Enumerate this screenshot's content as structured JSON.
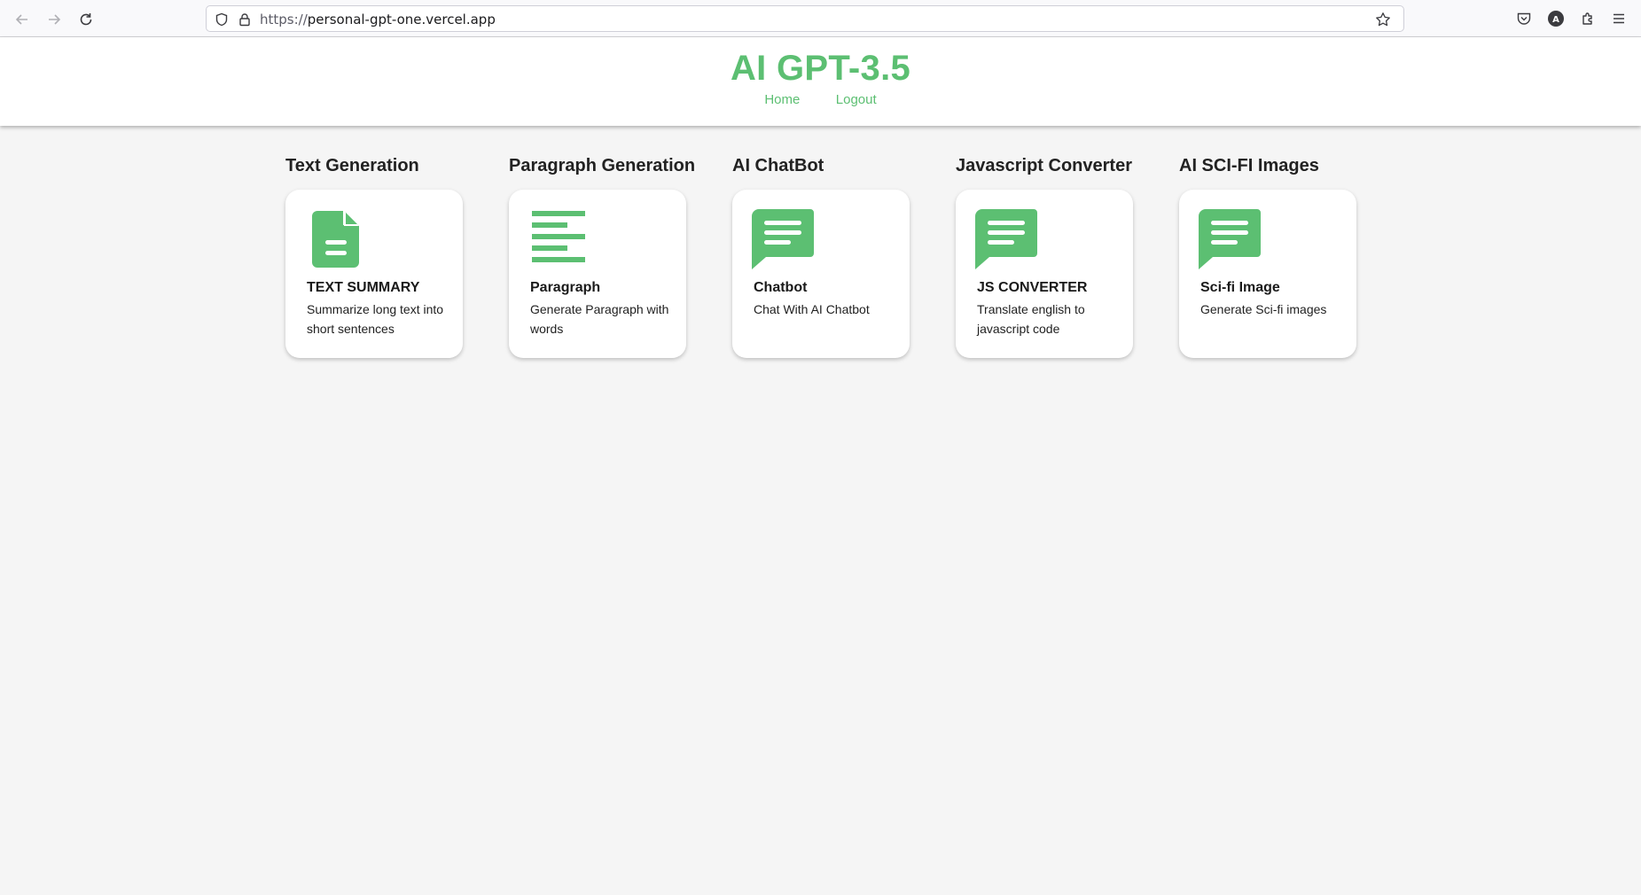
{
  "browser": {
    "url_scheme": "https://",
    "url_host": "personal-gpt-one.vercel.app",
    "icons": [
      "back-arrow-icon",
      "forward-arrow-icon",
      "reload-icon",
      "shield-icon",
      "lock-icon",
      "star-icon",
      "pocket-icon",
      "account-icon",
      "extensions-icon",
      "menu-icon"
    ],
    "account_initial": "A"
  },
  "header": {
    "brand": "AI GPT-3.5",
    "nav": [
      {
        "label": "Home"
      },
      {
        "label": "Logout"
      }
    ]
  },
  "features": [
    {
      "heading": "Text Generation",
      "icon": "document-icon",
      "title": "TEXT SUMMARY",
      "description": "Summarize long text into short sentences"
    },
    {
      "heading": "Paragraph Generation",
      "icon": "paragraph-lines-icon",
      "title": "Paragraph",
      "description": "Generate Paragraph with words"
    },
    {
      "heading": "AI ChatBot",
      "icon": "chat-bubble-icon",
      "title": "Chatbot",
      "description": "Chat With AI Chatbot"
    },
    {
      "heading": "Javascript Converter",
      "icon": "chat-bubble-icon",
      "title": "JS CONVERTER",
      "description": "Translate english to javascript code"
    },
    {
      "heading": "AI SCI-FI Images",
      "icon": "chat-bubble-icon",
      "title": "Sci-fi Image",
      "description": "Generate Sci-fi images"
    }
  ],
  "colors": {
    "accent": "#5cbf72",
    "page_background": "#f5f5f5",
    "card_background": "#ffffff"
  }
}
